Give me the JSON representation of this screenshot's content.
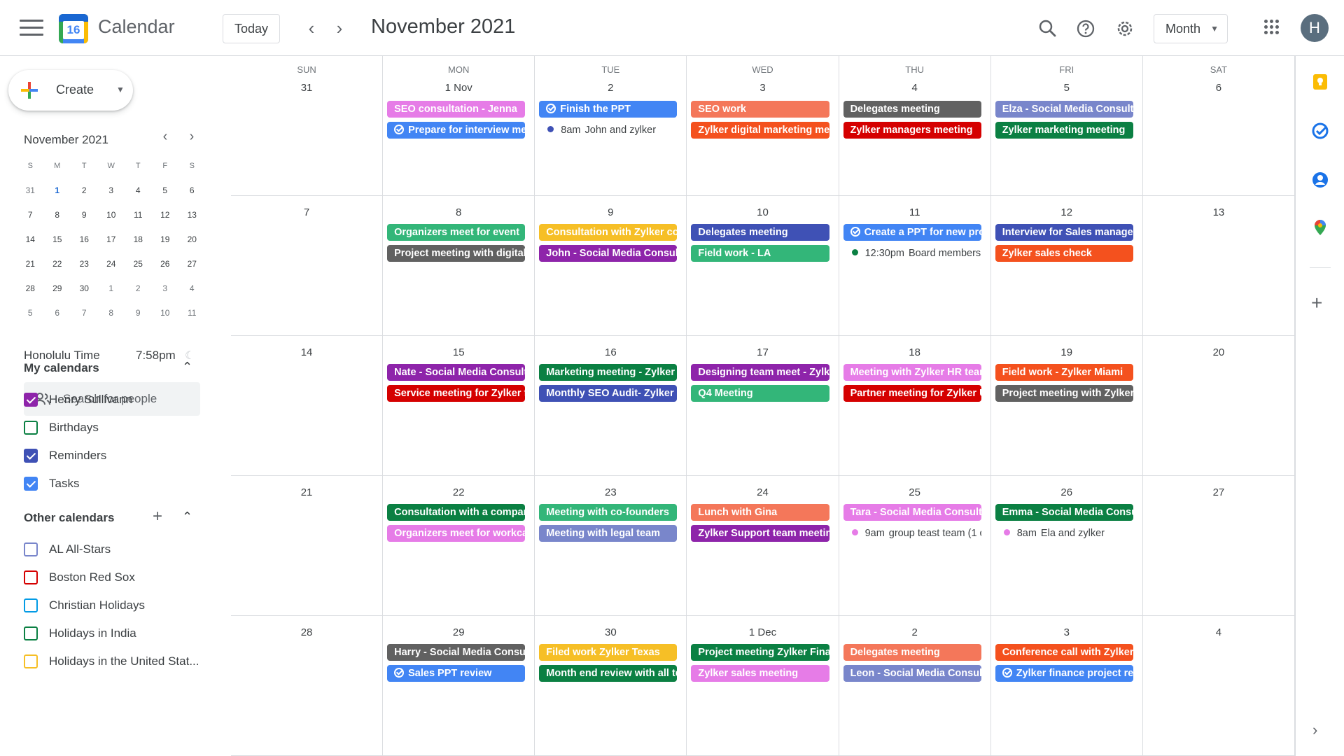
{
  "header": {
    "app_name": "Calendar",
    "logo_day": "16",
    "today_label": "Today",
    "period": "November 2021",
    "view": "Month",
    "avatar_initial": "H"
  },
  "sidebar": {
    "create_label": "Create",
    "mini_cal": {
      "title": "November 2021",
      "dow": [
        "S",
        "M",
        "T",
        "W",
        "T",
        "F",
        "S"
      ],
      "weeks": [
        [
          "31",
          "1",
          "2",
          "3",
          "4",
          "5",
          "6"
        ],
        [
          "7",
          "8",
          "9",
          "10",
          "11",
          "12",
          "13"
        ],
        [
          "14",
          "15",
          "16",
          "17",
          "18",
          "19",
          "20"
        ],
        [
          "21",
          "22",
          "23",
          "24",
          "25",
          "26",
          "27"
        ],
        [
          "28",
          "29",
          "30",
          "1",
          "2",
          "3",
          "4"
        ],
        [
          "5",
          "6",
          "7",
          "8",
          "9",
          "10",
          "11"
        ]
      ]
    },
    "timezone": {
      "label": "Honolulu Time",
      "time": "7:58pm"
    },
    "search_people_placeholder": "Search for people",
    "my_calendars": {
      "title": "My calendars",
      "items": [
        {
          "name": "Henry Sullivann",
          "color": "#8e24aa",
          "checked": true
        },
        {
          "name": "Birthdays",
          "color": "#0b8043",
          "checked": false
        },
        {
          "name": "Reminders",
          "color": "#3f51b5",
          "checked": true
        },
        {
          "name": "Tasks",
          "color": "#4285f4",
          "checked": true
        }
      ]
    },
    "other_calendars": {
      "title": "Other calendars",
      "items": [
        {
          "name": "AL All-Stars",
          "color": "#7986cb",
          "checked": false
        },
        {
          "name": "Boston Red Sox",
          "color": "#d50000",
          "checked": false
        },
        {
          "name": "Christian Holidays",
          "color": "#039be5",
          "checked": false
        },
        {
          "name": "Holidays in India",
          "color": "#0b8043",
          "checked": false
        },
        {
          "name": "Holidays in the United Stat...",
          "color": "#f6bf26",
          "checked": false
        }
      ]
    }
  },
  "month_grid": {
    "dow": [
      "SUN",
      "MON",
      "TUE",
      "WED",
      "THU",
      "FRI",
      "SAT"
    ],
    "weeks": [
      [
        {
          "date": "31",
          "events": []
        },
        {
          "date": "1 Nov",
          "events": [
            {
              "kind": "chip",
              "title": "SEO consultation - Jenna",
              "color": "#e67ce7"
            },
            {
              "kind": "chip",
              "title": "Prepare for interview me",
              "color": "#4285f4",
              "task": true
            }
          ]
        },
        {
          "date": "2",
          "events": [
            {
              "kind": "chip",
              "title": "Finish the PPT",
              "color": "#4285f4",
              "task": true
            },
            {
              "kind": "dot",
              "time": "8am",
              "title": "John and zylker",
              "color": "#3f51b5"
            }
          ]
        },
        {
          "date": "3",
          "events": [
            {
              "kind": "chip",
              "title": "SEO work",
              "color": "#f4775a"
            },
            {
              "kind": "chip",
              "title": "Zylker digital marketing me",
              "color": "#f4511e"
            }
          ]
        },
        {
          "date": "4",
          "events": [
            {
              "kind": "chip",
              "title": "Delegates meeting",
              "color": "#616161"
            },
            {
              "kind": "chip",
              "title": "Zylker managers meeting",
              "color": "#d50000"
            }
          ]
        },
        {
          "date": "5",
          "events": [
            {
              "kind": "chip",
              "title": "Elza - Social Media Consult",
              "color": "#7986cb"
            },
            {
              "kind": "chip",
              "title": "Zylker marketing meeting",
              "color": "#0b8043"
            }
          ]
        },
        {
          "date": "6",
          "events": []
        }
      ],
      [
        {
          "date": "7",
          "events": []
        },
        {
          "date": "8",
          "events": [
            {
              "kind": "chip",
              "title": "Organizers meet for event",
              "color": "#33b679"
            },
            {
              "kind": "chip",
              "title": "Project meeting with digital",
              "color": "#616161"
            }
          ]
        },
        {
          "date": "9",
          "events": [
            {
              "kind": "chip",
              "title": "Consultation with Zylker cor",
              "color": "#f6bf26"
            },
            {
              "kind": "chip",
              "title": "John - Social Media Consult",
              "color": "#8e24aa"
            }
          ]
        },
        {
          "date": "10",
          "events": [
            {
              "kind": "chip",
              "title": "Delegates meeting",
              "color": "#3f51b5"
            },
            {
              "kind": "chip",
              "title": "Field work - LA",
              "color": "#33b679"
            }
          ]
        },
        {
          "date": "11",
          "events": [
            {
              "kind": "chip",
              "title": "Create a PPT for new pro",
              "color": "#4285f4",
              "task": true
            },
            {
              "kind": "dot",
              "time": "12:30pm",
              "title": "Board members m",
              "color": "#0b8043"
            }
          ]
        },
        {
          "date": "12",
          "events": [
            {
              "kind": "chip",
              "title": "Interview for Sales manager",
              "color": "#3f51b5"
            },
            {
              "kind": "chip",
              "title": "Zylker sales check",
              "color": "#f4511e"
            }
          ]
        },
        {
          "date": "13",
          "events": []
        }
      ],
      [
        {
          "date": "14",
          "events": []
        },
        {
          "date": "15",
          "events": [
            {
              "kind": "chip",
              "title": "Nate - Social Media Consult",
              "color": "#8e24aa"
            },
            {
              "kind": "chip",
              "title": "Service meeting for Zylker f",
              "color": "#d50000"
            }
          ]
        },
        {
          "date": "16",
          "events": [
            {
              "kind": "chip",
              "title": "Marketing meeting - Zylker",
              "color": "#0b8043"
            },
            {
              "kind": "chip",
              "title": "Monthly SEO Audit- Zylker",
              "color": "#3f51b5"
            }
          ]
        },
        {
          "date": "17",
          "events": [
            {
              "kind": "chip",
              "title": "Designing team meet - Zylk",
              "color": "#8e24aa"
            },
            {
              "kind": "chip",
              "title": "Q4 Meeting",
              "color": "#33b679"
            }
          ]
        },
        {
          "date": "18",
          "events": [
            {
              "kind": "chip",
              "title": "Meeting with Zylker HR tear",
              "color": "#e67ce7"
            },
            {
              "kind": "chip",
              "title": "Partner meeting for Zylker U",
              "color": "#d50000"
            }
          ]
        },
        {
          "date": "19",
          "events": [
            {
              "kind": "chip",
              "title": "Field work - Zylker Miami",
              "color": "#f4511e"
            },
            {
              "kind": "chip",
              "title": "Project meeting with Zylker",
              "color": "#616161"
            }
          ]
        },
        {
          "date": "20",
          "events": []
        }
      ],
      [
        {
          "date": "21",
          "events": []
        },
        {
          "date": "22",
          "events": [
            {
              "kind": "chip",
              "title": "Consultation with a compar",
              "color": "#0b8043"
            },
            {
              "kind": "chip",
              "title": "Organizers meet for workca",
              "color": "#e67ce7"
            }
          ]
        },
        {
          "date": "23",
          "events": [
            {
              "kind": "chip",
              "title": "Meeting with co-founders",
              "color": "#33b679"
            },
            {
              "kind": "chip",
              "title": "Meeting with legal team",
              "color": "#7986cb"
            }
          ]
        },
        {
          "date": "24",
          "events": [
            {
              "kind": "chip",
              "title": "Lunch with Gina",
              "color": "#f4775a"
            },
            {
              "kind": "chip",
              "title": "Zylker Support team meetin",
              "color": "#8e24aa"
            }
          ]
        },
        {
          "date": "25",
          "events": [
            {
              "kind": "chip",
              "title": "Tara - Social Media Consult",
              "color": "#e67ce7"
            },
            {
              "kind": "dot",
              "time": "9am",
              "title": "group teast team (1 c",
              "color": "#e67ce7"
            }
          ]
        },
        {
          "date": "26",
          "events": [
            {
              "kind": "chip",
              "title": "Emma - Social Media Consu",
              "color": "#0b8043"
            },
            {
              "kind": "dot",
              "time": "8am",
              "title": "Ela and zylker",
              "color": "#e67ce7"
            }
          ]
        },
        {
          "date": "27",
          "events": []
        }
      ],
      [
        {
          "date": "28",
          "events": []
        },
        {
          "date": "29",
          "events": [
            {
              "kind": "chip",
              "title": "Harry - Social Media Consul",
              "color": "#616161"
            },
            {
              "kind": "chip",
              "title": "Sales PPT review",
              "color": "#4285f4",
              "task": true
            }
          ]
        },
        {
          "date": "30",
          "events": [
            {
              "kind": "chip",
              "title": "Filed work Zylker Texas",
              "color": "#f6bf26"
            },
            {
              "kind": "chip",
              "title": "Month end review with all te",
              "color": "#0b8043"
            }
          ]
        },
        {
          "date": "1 Dec",
          "events": [
            {
              "kind": "chip",
              "title": "Project meeting Zylker Fina",
              "color": "#0b8043"
            },
            {
              "kind": "chip",
              "title": "Zylker sales meeting",
              "color": "#e67ce7"
            }
          ]
        },
        {
          "date": "2",
          "events": [
            {
              "kind": "chip",
              "title": "Delegates meeting",
              "color": "#f4775a"
            },
            {
              "kind": "chip",
              "title": "Leon - Social Media Consult",
              "color": "#7986cb"
            }
          ]
        },
        {
          "date": "3",
          "events": [
            {
              "kind": "chip",
              "title": "Conference call with Zylker",
              "color": "#f4511e"
            },
            {
              "kind": "chip",
              "title": "Zylker finance project re",
              "color": "#4285f4",
              "task": true
            }
          ]
        },
        {
          "date": "4",
          "events": []
        }
      ]
    ]
  },
  "colors": {
    "accent": "#1a73e8",
    "border": "#dadce0"
  }
}
